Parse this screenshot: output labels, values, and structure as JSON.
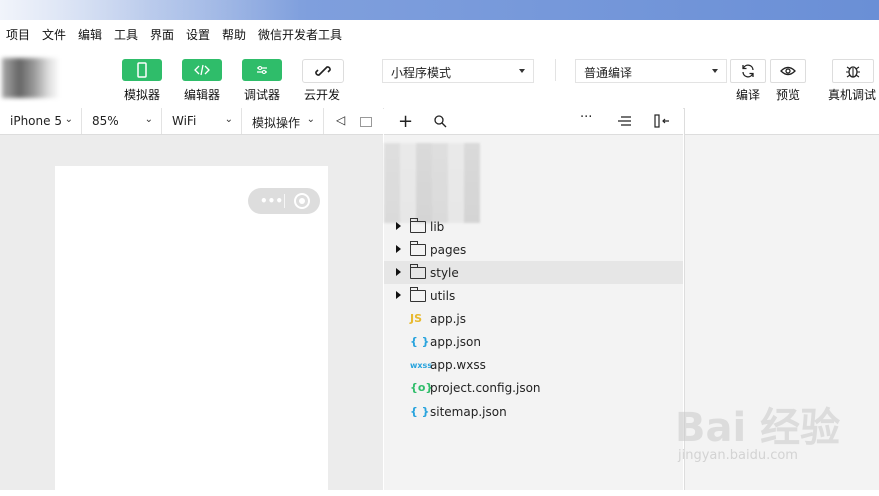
{
  "menu": [
    "项目",
    "文件",
    "编辑",
    "工具",
    "界面",
    "设置",
    "帮助",
    "微信开发者工具"
  ],
  "toolbar": {
    "simulator": "模拟器",
    "editor": "编辑器",
    "debugger": "调试器",
    "cloud": "云开发",
    "mode_select": "小程序模式",
    "compile_select": "普通编译",
    "compile": "编译",
    "preview": "预览",
    "remote_debug": "真机调试"
  },
  "simulator_bar": {
    "device": "iPhone 5",
    "zoom": "85%",
    "network": "WiFi",
    "ops": "模拟操作"
  },
  "files": [
    {
      "type": "folder",
      "name": "lib"
    },
    {
      "type": "folder",
      "name": "pages"
    },
    {
      "type": "folder",
      "name": "style",
      "selected": true
    },
    {
      "type": "folder",
      "name": "utils"
    },
    {
      "type": "js",
      "icon": "JS",
      "name": "app.js"
    },
    {
      "type": "json",
      "icon": "{ }",
      "name": "app.json"
    },
    {
      "type": "wxss",
      "icon": "wxss",
      "name": "app.wxss"
    },
    {
      "type": "config",
      "icon": "{o}",
      "name": "project.config.json"
    },
    {
      "type": "json",
      "icon": "{ }",
      "name": "sitemap.json"
    }
  ],
  "colors": {
    "accent": "#2fbd6a",
    "js": "#e8b92e",
    "json": "#27a3dd",
    "config": "#2fbd6a"
  },
  "watermark": {
    "brand": "Bai 经验",
    "url": "jingyan.baidu.com"
  }
}
